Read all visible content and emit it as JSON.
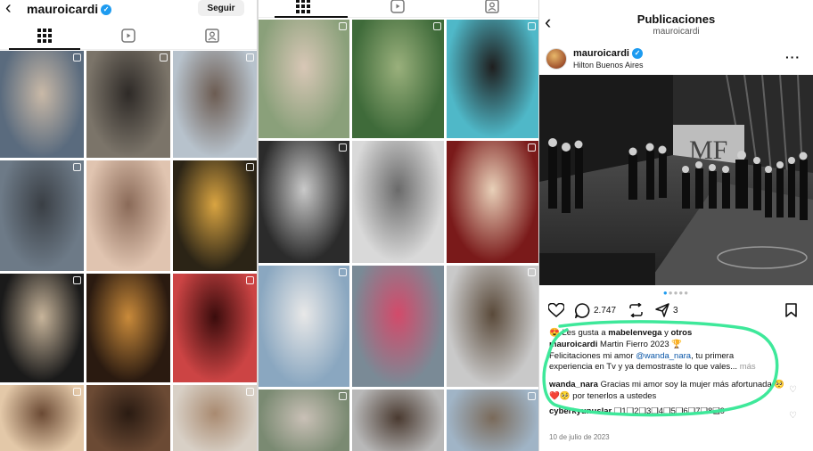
{
  "left_profile": {
    "username": "mauroicardi",
    "follow_label": "Seguir"
  },
  "center_grid": {},
  "post": {
    "header_title": "Publicaciones",
    "header_subtitle": "mauroicardi",
    "author": "mauroicardi",
    "location": "Hilton Buenos Aires",
    "comment_count": "2.747",
    "share_count": "3",
    "likes_prefix": "Les gusta a",
    "likes_user": "mabelenvega",
    "likes_and": "y",
    "likes_others": "otros",
    "caption_user": "mauroicardi",
    "caption_line1": "Martin Fierro 2023 🏆",
    "caption_line2_pre": "Felicitaciones mi amor",
    "caption_mention": "@wanda_nara",
    "caption_line2_post": ", tu primera",
    "caption_line3": "experiencia en Tv y ya demostraste lo que vales...",
    "caption_more": "más",
    "comment1_user": "wanda_nara",
    "comment1_text": "Gracias mi amor soy la mujer más afortunada 🥺❤️🥺 por tenerlos a ustedes",
    "comment2_user": "cyberkyunuslar",
    "comment2_text": "❏1❏2❏3❏4❏5❏6❏7❏8❏9",
    "date": "10 de julio de 2023",
    "colors": {
      "verified": "#1d9bf0",
      "annotation": "#3ee89a",
      "mention": "#0b57a8"
    }
  }
}
